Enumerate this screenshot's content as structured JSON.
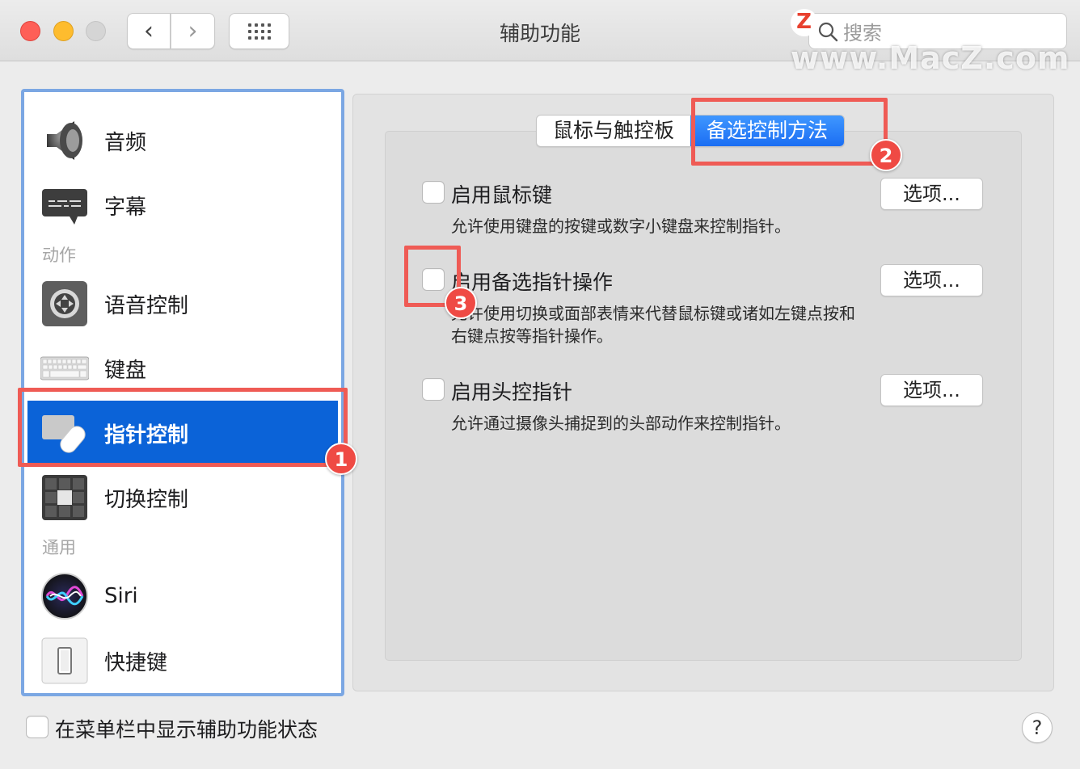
{
  "window": {
    "title": "辅助功能",
    "search_placeholder": "搜索",
    "watermark": "www.MacZ.com",
    "watermark_logo": "Z"
  },
  "toolbar": {
    "back_icon": "‹",
    "forward_icon": "›"
  },
  "sidebar": {
    "items": [
      {
        "label": "音频",
        "icon": "speaker-icon"
      },
      {
        "label": "字幕",
        "icon": "captions-icon"
      },
      {
        "section": "动作"
      },
      {
        "label": "语音控制",
        "icon": "voice-control-icon"
      },
      {
        "label": "键盘",
        "icon": "keyboard-icon"
      },
      {
        "label": "指针控制",
        "icon": "pointer-control-icon",
        "selected": true
      },
      {
        "label": "切换控制",
        "icon": "switch-control-icon"
      },
      {
        "section": "通用"
      },
      {
        "label": "Siri",
        "icon": "siri-icon"
      },
      {
        "label": "快捷键",
        "icon": "shortcut-icon"
      }
    ]
  },
  "tabs": [
    {
      "label": "鼠标与触控板",
      "active": false
    },
    {
      "label": "备选控制方法",
      "active": true
    }
  ],
  "options": [
    {
      "title": "启用鼠标键",
      "description": [
        "允许使用键盘的按键或数字小键盘来控制指针。"
      ],
      "button": "选项...",
      "checked": false
    },
    {
      "title": "启用备选指针操作",
      "description": [
        "允许使用切换或面部表情来代替鼠标键或诸如左键点按和",
        "右键点按等指针操作。"
      ],
      "button": "选项...",
      "checked": false
    },
    {
      "title": "启用头控指针",
      "description": [
        "允许通过摄像头捕捉到的头部动作来控制指针。"
      ],
      "button": "选项...",
      "checked": false
    }
  ],
  "footer": {
    "show_status_label": "在菜单栏中显示辅助功能状态",
    "help_label": "?"
  },
  "annotations": [
    "1",
    "2",
    "3"
  ],
  "colors": {
    "selection": "#0b63d8",
    "annotation": "#ef5b55",
    "tab_active": "#1b6ef3"
  }
}
